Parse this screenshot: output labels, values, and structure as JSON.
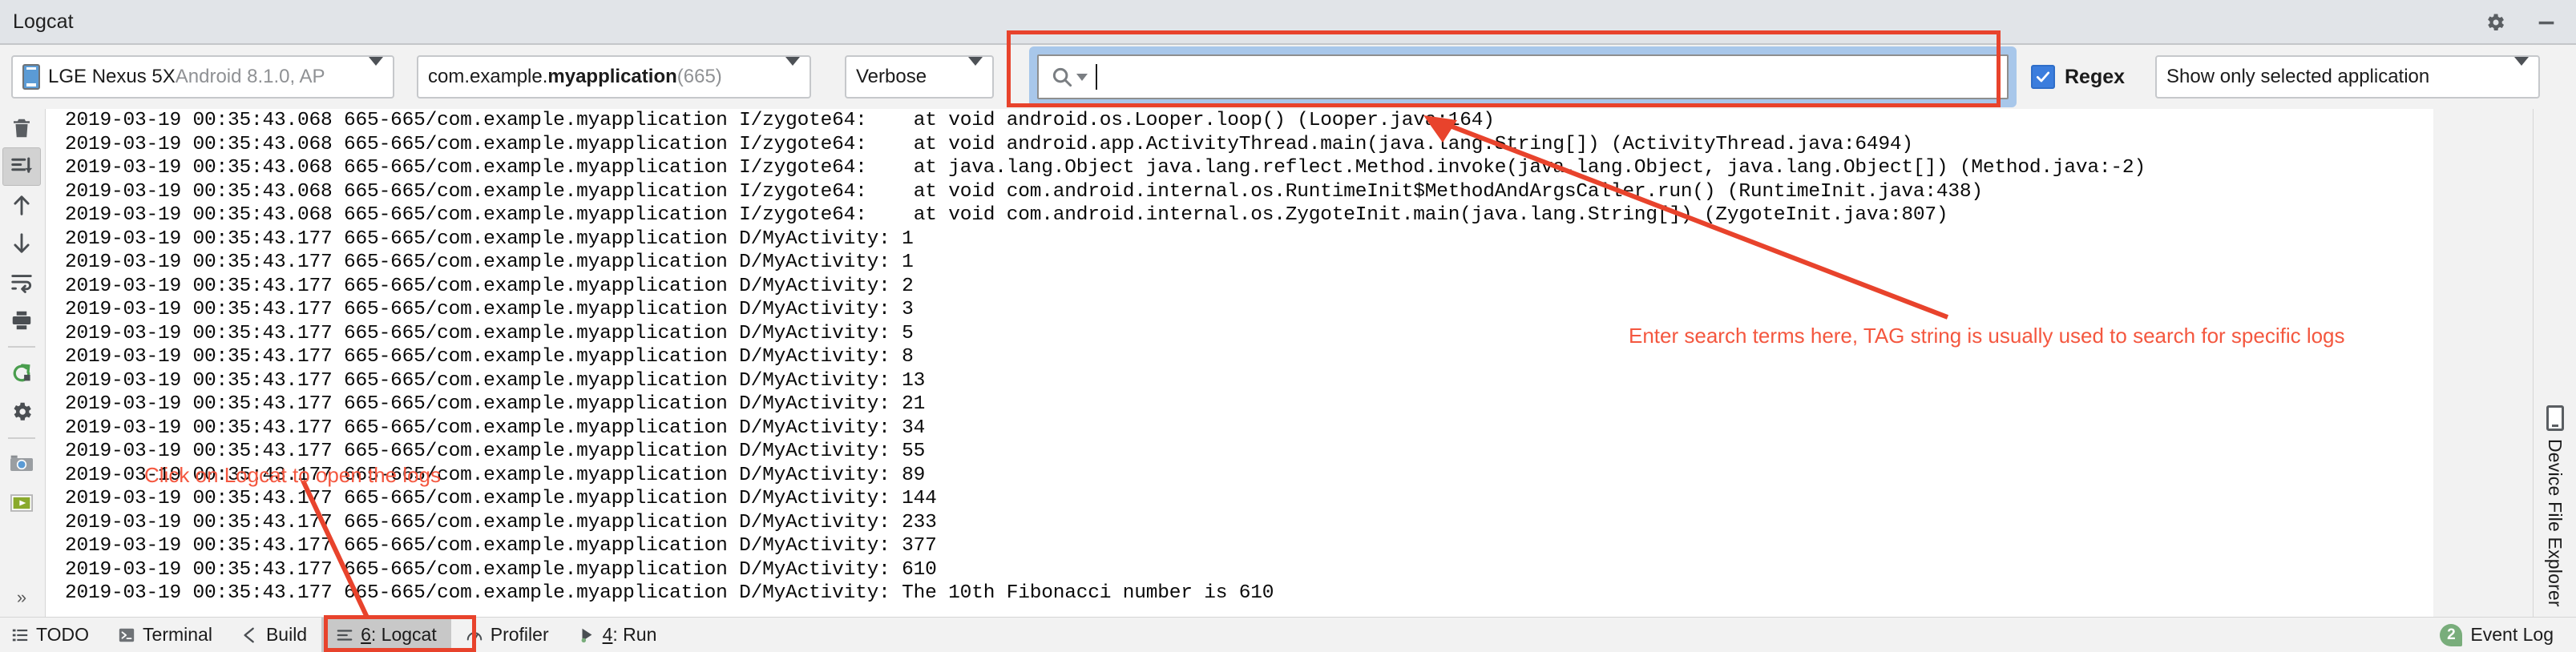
{
  "window": {
    "title": "Logcat",
    "settings_icon": "gear-icon",
    "minimize_icon": "minimize-icon"
  },
  "toolbar": {
    "device": {
      "name": "LGE Nexus 5X",
      "details": " Android 8.1.0, AP",
      "icon": "phone-icon"
    },
    "package": {
      "prefix": "com.example.",
      "name": "myapplication",
      "pid": " (665)"
    },
    "log_level": "Verbose",
    "search": {
      "value": "",
      "placeholder": "",
      "icon": "search-icon"
    },
    "regex": {
      "label": "Regex",
      "checked": true
    },
    "filter": "Show only selected application"
  },
  "sidebar_left": {
    "items": [
      {
        "name": "clear-logcat-icon",
        "title": "Clear logcat"
      },
      {
        "name": "scroll-to-end-icon",
        "title": "Scroll to the end",
        "active": true
      },
      {
        "name": "up-arrow-icon",
        "title": "Up the stack trace"
      },
      {
        "name": "down-arrow-icon",
        "title": "Down the stack trace"
      },
      {
        "name": "soft-wrap-icon",
        "title": "Use soft wraps"
      },
      {
        "name": "print-icon",
        "title": "Print"
      },
      {
        "name": "restart-icon",
        "title": "Restart"
      },
      {
        "name": "settings-gear-icon",
        "title": "Logcat header format"
      },
      {
        "name": "screenshot-camera-icon",
        "title": "Screen capture"
      },
      {
        "name": "screen-record-icon",
        "title": "Screen record"
      },
      {
        "name": "expand-chevrons-icon",
        "title": "More"
      }
    ]
  },
  "sidebar_right": {
    "label": "Device File Explorer",
    "icon": "phone-icon"
  },
  "log": {
    "lines": [
      {
        "prefix": "2019-03-19 00:35:43.068 665-665/com.example.myapplication I/zygote64:",
        "indent": true,
        "message": "at void android.os.Looper.loop() (Looper.java:164)"
      },
      {
        "prefix": "2019-03-19 00:35:43.068 665-665/com.example.myapplication I/zygote64:",
        "indent": true,
        "message": "at void android.app.ActivityThread.main(java.lang.String[]) (ActivityThread.java:6494)"
      },
      {
        "prefix": "2019-03-19 00:35:43.068 665-665/com.example.myapplication I/zygote64:",
        "indent": true,
        "message": "at java.lang.Object java.lang.reflect.Method.invoke(java.lang.Object, java.lang.Object[]) (Method.java:-2)"
      },
      {
        "prefix": "2019-03-19 00:35:43.068 665-665/com.example.myapplication I/zygote64:",
        "indent": true,
        "message": "at void com.android.internal.os.RuntimeInit$MethodAndArgsCaller.run() (RuntimeInit.java:438)"
      },
      {
        "prefix": "2019-03-19 00:35:43.068 665-665/com.example.myapplication I/zygote64:",
        "indent": true,
        "message": "at void com.android.internal.os.ZygoteInit.main(java.lang.String[]) (ZygoteInit.java:807)"
      },
      {
        "prefix": "2019-03-19 00:35:43.177 665-665/com.example.myapplication D/MyActivity:",
        "indent": false,
        "message": " 1"
      },
      {
        "prefix": "2019-03-19 00:35:43.177 665-665/com.example.myapplication D/MyActivity:",
        "indent": false,
        "message": " 1"
      },
      {
        "prefix": "2019-03-19 00:35:43.177 665-665/com.example.myapplication D/MyActivity:",
        "indent": false,
        "message": " 2"
      },
      {
        "prefix": "2019-03-19 00:35:43.177 665-665/com.example.myapplication D/MyActivity:",
        "indent": false,
        "message": " 3"
      },
      {
        "prefix": "2019-03-19 00:35:43.177 665-665/com.example.myapplication D/MyActivity:",
        "indent": false,
        "message": " 5"
      },
      {
        "prefix": "2019-03-19 00:35:43.177 665-665/com.example.myapplication D/MyActivity:",
        "indent": false,
        "message": " 8"
      },
      {
        "prefix": "2019-03-19 00:35:43.177 665-665/com.example.myapplication D/MyActivity:",
        "indent": false,
        "message": " 13"
      },
      {
        "prefix": "2019-03-19 00:35:43.177 665-665/com.example.myapplication D/MyActivity:",
        "indent": false,
        "message": " 21"
      },
      {
        "prefix": "2019-03-19 00:35:43.177 665-665/com.example.myapplication D/MyActivity:",
        "indent": false,
        "message": " 34"
      },
      {
        "prefix": "2019-03-19 00:35:43.177 665-665/com.example.myapplication D/MyActivity:",
        "indent": false,
        "message": " 55"
      },
      {
        "prefix": "2019-03-19 00:35:43.177 665-665/com.example.myapplication D/MyActivity:",
        "indent": false,
        "message": " 89"
      },
      {
        "prefix": "2019-03-19 00:35:43.177 665-665/com.example.myapplication D/MyActivity:",
        "indent": false,
        "message": " 144"
      },
      {
        "prefix": "2019-03-19 00:35:43.177 665-665/com.example.myapplication D/MyActivity:",
        "indent": false,
        "message": " 233"
      },
      {
        "prefix": "2019-03-19 00:35:43.177 665-665/com.example.myapplication D/MyActivity:",
        "indent": false,
        "message": " 377"
      },
      {
        "prefix": "2019-03-19 00:35:43.177 665-665/com.example.myapplication D/MyActivity:",
        "indent": false,
        "message": " 610"
      },
      {
        "prefix": "2019-03-19 00:35:43.177 665-665/com.example.myapplication D/MyActivity:",
        "indent": false,
        "message": " The 10th Fibonacci number is 610"
      }
    ]
  },
  "annotations": {
    "search_note": "Enter search terms here, TAG string is usually used to search for specific logs",
    "logcat_note": "Click on Logcat to open the logs",
    "color": "#f4573f",
    "box_color": "#e8432c"
  },
  "statusbar": {
    "items": [
      {
        "label": "TODO",
        "icon": "todo-list-icon",
        "active": false
      },
      {
        "label": "Terminal",
        "icon": "terminal-icon",
        "active": false
      },
      {
        "label": "Build",
        "icon": "build-hammer-icon",
        "active": false
      },
      {
        "label": "6: Logcat",
        "icon": "logcat-lines-icon",
        "active": true,
        "mnemonic": "6"
      },
      {
        "label": "Profiler",
        "icon": "profiler-gauge-icon",
        "active": false
      },
      {
        "label": "4: Run",
        "icon": "run-play-icon",
        "active": false,
        "mnemonic": "4"
      }
    ],
    "event_log": {
      "label": "Event Log",
      "count": "2"
    }
  }
}
